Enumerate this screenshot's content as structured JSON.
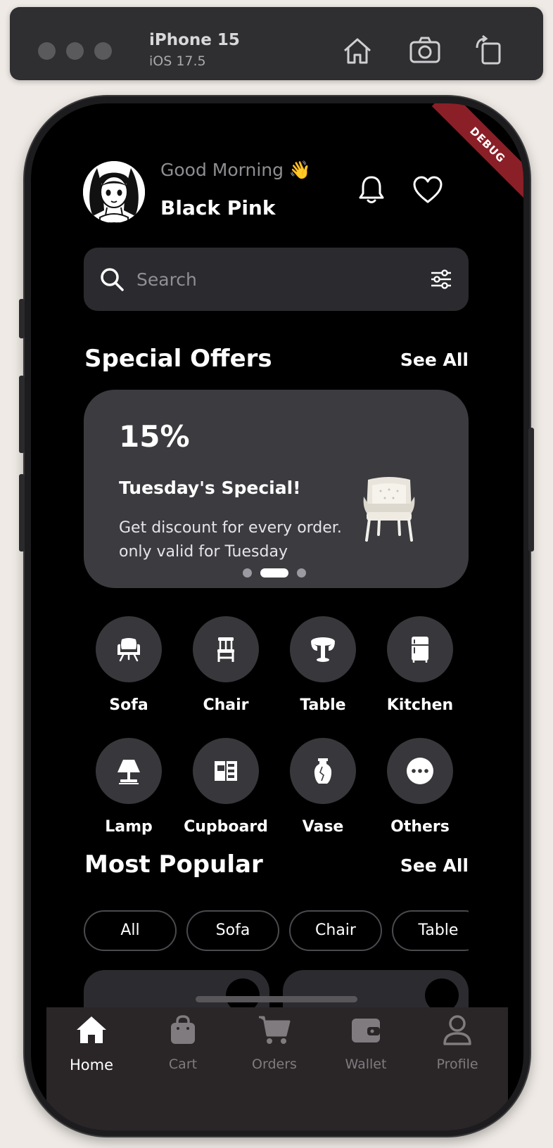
{
  "simulator": {
    "device": "iPhone 15",
    "os": "iOS 17.5",
    "icons": [
      "home-icon",
      "screenshot-icon",
      "rotate-icon"
    ]
  },
  "debug_banner": "DEBUG",
  "header": {
    "greeting": "Good Morning 👋",
    "user_name": "Black Pink",
    "icons": [
      "bell-icon",
      "heart-icon"
    ]
  },
  "search": {
    "placeholder": "Search"
  },
  "special_offers": {
    "title": "Special Offers",
    "see_all": "See All",
    "offer": {
      "discount": "15%",
      "title": "Tuesday's Special!",
      "description": "Get discount for every order. only valid for Tuesday"
    },
    "pager": {
      "count": 3,
      "active_index": 1
    }
  },
  "categories": [
    {
      "label": "Sofa",
      "icon": "sofa-icon"
    },
    {
      "label": "Chair",
      "icon": "chair-icon"
    },
    {
      "label": "Table",
      "icon": "table-icon"
    },
    {
      "label": "Kitchen",
      "icon": "kitchen-icon"
    },
    {
      "label": "Lamp",
      "icon": "lamp-icon"
    },
    {
      "label": "Cupboard",
      "icon": "cupboard-icon"
    },
    {
      "label": "Vase",
      "icon": "vase-icon"
    },
    {
      "label": "Others",
      "icon": "more-icon"
    }
  ],
  "most_popular": {
    "title": "Most Popular",
    "see_all": "See All",
    "filters": [
      "All",
      "Sofa",
      "Chair",
      "Table"
    ]
  },
  "tabs": [
    {
      "label": "Home",
      "icon": "home-icon",
      "active": true
    },
    {
      "label": "Cart",
      "icon": "bag-icon",
      "active": false
    },
    {
      "label": "Orders",
      "icon": "cart-icon",
      "active": false
    },
    {
      "label": "Wallet",
      "icon": "wallet-icon",
      "active": false
    },
    {
      "label": "Profile",
      "icon": "person-icon",
      "active": false
    }
  ],
  "colors": {
    "background": "#000000",
    "surface": "#2b2b2f",
    "card": "#3b3b40",
    "debug": "#8b1f27",
    "active_tab": "#ffffff",
    "inactive_tab": "#7f7b7e"
  }
}
